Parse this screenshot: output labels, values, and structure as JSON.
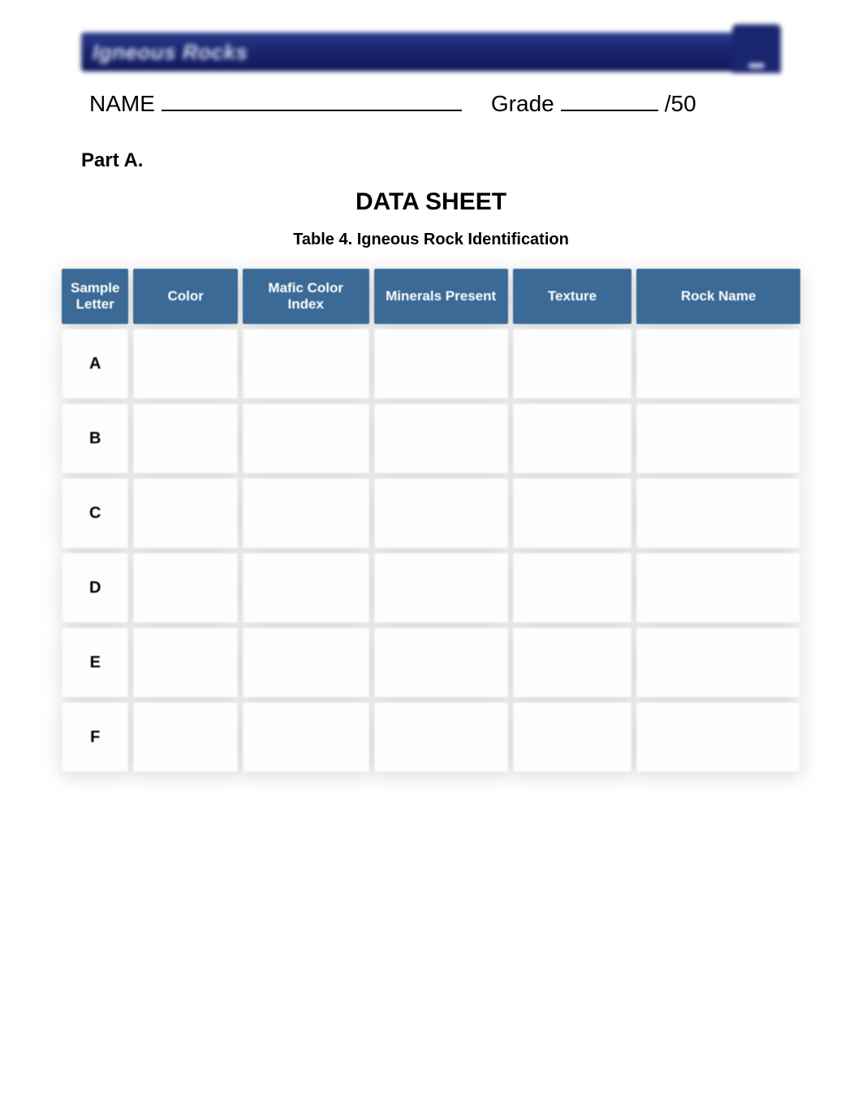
{
  "banner": {
    "title": "Igneous Rocks"
  },
  "header": {
    "name_label": "NAME",
    "grade_label": "Grade",
    "grade_total": "/50"
  },
  "section": {
    "part_label": "Part A.",
    "sheet_title": "DATA SHEET",
    "table_caption": "Table 4. Igneous Rock Identification"
  },
  "table": {
    "headers": {
      "sample": "Sample Letter",
      "color": "Color",
      "mafic": "Mafic Color Index",
      "minerals": "Minerals Present",
      "texture": "Texture",
      "rockname": "Rock Name"
    },
    "rows": [
      {
        "sample": "A",
        "color": "",
        "mafic": "",
        "minerals": "",
        "texture": "",
        "rockname": ""
      },
      {
        "sample": "B",
        "color": "",
        "mafic": "",
        "minerals": "",
        "texture": "",
        "rockname": ""
      },
      {
        "sample": "C",
        "color": "",
        "mafic": "",
        "minerals": "",
        "texture": "",
        "rockname": ""
      },
      {
        "sample": "D",
        "color": "",
        "mafic": "",
        "minerals": "",
        "texture": "",
        "rockname": ""
      },
      {
        "sample": "E",
        "color": "",
        "mafic": "",
        "minerals": "",
        "texture": "",
        "rockname": ""
      },
      {
        "sample": "F",
        "color": "",
        "mafic": "",
        "minerals": "",
        "texture": "",
        "rockname": ""
      }
    ]
  }
}
